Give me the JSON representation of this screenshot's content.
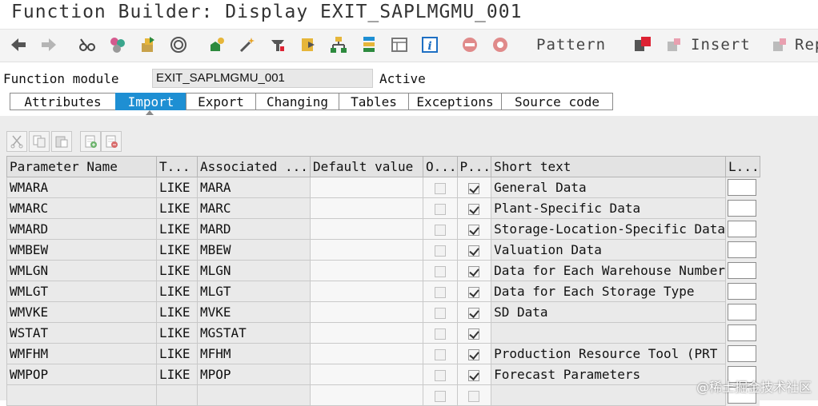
{
  "window": {
    "title": "Function Builder: Display EXIT_SAPLMGMU_001"
  },
  "toolbar": {
    "pattern_label": "Pattern",
    "insert_label": "Insert",
    "replace_label": "Rep",
    "icons": [
      "back-arrow",
      "forward-arrow",
      "glasses",
      "check",
      "activate",
      "where-used",
      "object-list",
      "magic-wand",
      "test",
      "other-object",
      "display-object-list",
      "hierarchy",
      "navigation",
      "screen",
      "info",
      "breakpoint",
      "session-breakpoint",
      "pattern",
      "insert",
      "replace"
    ]
  },
  "header": {
    "fm_label": "Function module",
    "fm_value": "EXIT_SAPLMGMU_001",
    "status": "Active"
  },
  "tabs": [
    "Attributes",
    "Import",
    "Export",
    "Changing",
    "Tables",
    "Exceptions",
    "Source code"
  ],
  "active_tab": "Import",
  "grid": {
    "toolbar_icons": [
      "cut",
      "copy",
      "paste",
      "insert-row",
      "delete-row"
    ],
    "columns": [
      "Parameter Name",
      "T...",
      "Associated ...",
      "Default value",
      "O...",
      "P...",
      "Short text",
      "L..."
    ],
    "rows": [
      {
        "name": "WMARA",
        "type": "LIKE",
        "assoc": "MARA",
        "default": "",
        "optional": false,
        "pass": true,
        "text": "General Data"
      },
      {
        "name": "WMARC",
        "type": "LIKE",
        "assoc": "MARC",
        "default": "",
        "optional": false,
        "pass": true,
        "text": "Plant-Specific Data"
      },
      {
        "name": "WMARD",
        "type": "LIKE",
        "assoc": "MARD",
        "default": "",
        "optional": false,
        "pass": true,
        "text": "Storage-Location-Specific Data"
      },
      {
        "name": "WMBEW",
        "type": "LIKE",
        "assoc": "MBEW",
        "default": "",
        "optional": false,
        "pass": true,
        "text": "Valuation Data"
      },
      {
        "name": "WMLGN",
        "type": "LIKE",
        "assoc": "MLGN",
        "default": "",
        "optional": false,
        "pass": true,
        "text": "Data for Each Warehouse Number"
      },
      {
        "name": "WMLGT",
        "type": "LIKE",
        "assoc": "MLGT",
        "default": "",
        "optional": false,
        "pass": true,
        "text": "Data for Each Storage Type"
      },
      {
        "name": "WMVKE",
        "type": "LIKE",
        "assoc": "MVKE",
        "default": "",
        "optional": false,
        "pass": true,
        "text": "SD Data"
      },
      {
        "name": "WSTAT",
        "type": "LIKE",
        "assoc": "MGSTAT",
        "default": "",
        "optional": false,
        "pass": true,
        "text": ""
      },
      {
        "name": "WMFHM",
        "type": "LIKE",
        "assoc": "MFHM",
        "default": "",
        "optional": false,
        "pass": true,
        "text": "Production Resource Tool (PRT"
      },
      {
        "name": "WMPOP",
        "type": "LIKE",
        "assoc": "MPOP",
        "default": "",
        "optional": false,
        "pass": true,
        "text": "Forecast Parameters"
      },
      {
        "name": "",
        "type": "",
        "assoc": "",
        "default": "",
        "optional": false,
        "pass": false,
        "text": ""
      }
    ]
  },
  "watermark": "@稀土掘金技术社区"
}
